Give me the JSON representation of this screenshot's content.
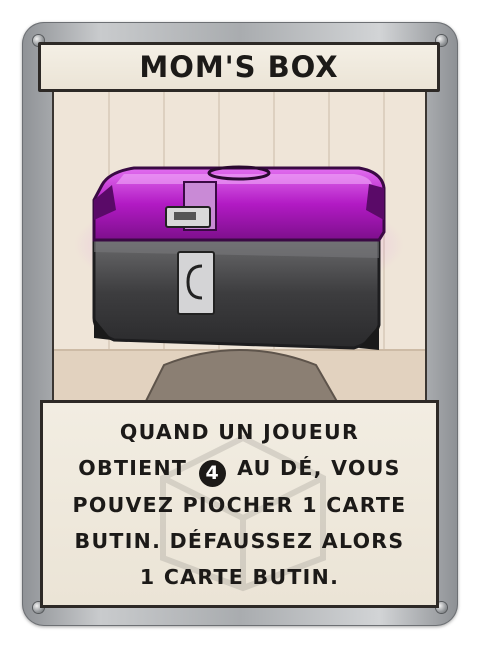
{
  "card": {
    "title": "MOM'S BOX",
    "rules_lines": [
      "QUAND UN JOUEUR",
      "AU DÉ, VOUS",
      "POUVEZ PIOCHER 1 CARTE",
      "BUTIN. DÉFAUSSEZ ALORS",
      "1 CARTE BUTIN."
    ],
    "obtient_word": "OBTIENT",
    "die_value": "4",
    "colors": {
      "box_lid": "#b21ac4",
      "box_body": "#3d3d3f",
      "background": "#efe5d8",
      "frame": "#b5b8bb"
    },
    "art_icon": "purple-treasure-chest"
  }
}
